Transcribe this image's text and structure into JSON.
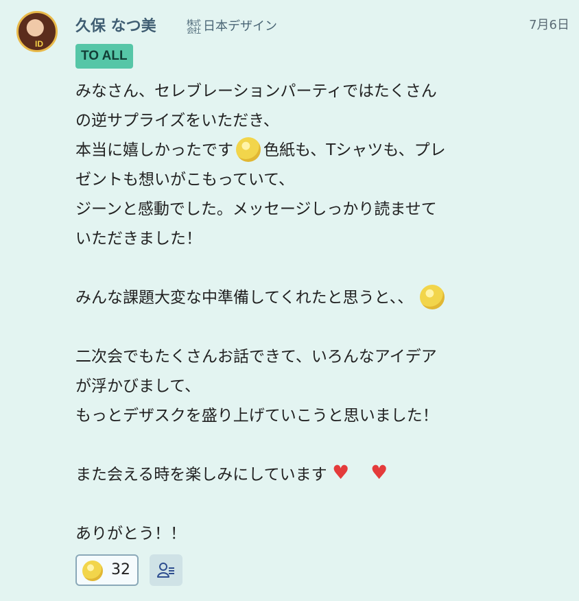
{
  "header": {
    "name": "久保 なつ美",
    "company_prefix": "株式会社",
    "company_name": "日本デザイン",
    "date": "7月6日"
  },
  "tag": {
    "label": "TO ALL"
  },
  "message": {
    "lines": [
      "みなさん、セレブレーションパーティではたくさん",
      "の逆サプライズをいただき、",
      "本当に嬉しかったです",
      "色紙も、Tシャツも、プレ",
      "ゼントも想いがこもっていて、",
      "ジーンと感動でした。メッセージしっかり読ませて",
      "いただきました！",
      "みんな課題大変な中準備してくれたと思うと、、",
      "二次会でもたくさんお話できて、いろんなアイデア",
      "が浮かびまして、",
      "もっとデザスクを盛り上げていこうと思いました！",
      "また会える時を楽しみにしています",
      "ありがとう！！"
    ]
  },
  "reactions": {
    "emoji_count": "32"
  },
  "icons": {
    "avatar": "user-avatar",
    "smile": "smiling-face-icon",
    "sad": "sad-face-icon",
    "heart": "heart-icon",
    "reaction": "pleading-face-icon",
    "users": "users-list-icon"
  },
  "colors": {
    "background": "#e3f4f1",
    "name": "#3f5d72",
    "tag_bg": "#56c6a7",
    "heart": "#e43b3b"
  }
}
